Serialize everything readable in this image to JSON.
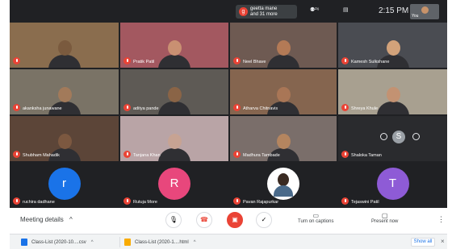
{
  "topbar": {
    "badge_letter": "g",
    "participants_badge": "geetta mane\nand 31 more",
    "layout_icon": "people-icon",
    "chat_icon": "chat-icon",
    "time": "2:15 PM",
    "self_label": "You"
  },
  "tiles": [
    {
      "name": "",
      "color": "#8a6d4e",
      "skin": "#7a5a3e"
    },
    {
      "name": "Pratik Patil",
      "color": "#a35860",
      "skin": "#c99072"
    },
    {
      "name": "Neel Bhave",
      "color": "#6e5a52",
      "skin": "#b37a56"
    },
    {
      "name": "Kamesh Sulkshane",
      "color": "#4a4c52",
      "skin": "#d2a27a"
    },
    {
      "name": "akanksha junawane",
      "color": "#7a7366",
      "skin": "#a27a5a"
    },
    {
      "name": "aditya pande",
      "color": "#5e5a55",
      "skin": "#8a6446"
    },
    {
      "name": "Atharva Chitnavis",
      "color": "#85654f",
      "skin": "#a97656"
    },
    {
      "name": "Shreya Khule",
      "color": "#a8a090",
      "skin": "#c39272"
    },
    {
      "name": "Shubham Mahadik",
      "color": "#5c4538",
      "skin": "#7c5840"
    },
    {
      "name": "Tanjana Khan",
      "color": "#b9a4a6",
      "skin": "#c7a393"
    },
    {
      "name": "Madhura Tambade",
      "color": "#7a6e6a",
      "skin": "#b4855f"
    },
    {
      "name": "Shaloka Taman",
      "color": "#2a2b2e",
      "skin": "#2a2b2e"
    }
  ],
  "avatars": [
    {
      "letter": "r",
      "name": "ruchira dadhane",
      "color": "#1a73e8"
    },
    {
      "letter": "R",
      "name": "Rutuja More",
      "color": "#e8477c"
    },
    {
      "letter": "",
      "name": "Pavan Rajapurkar",
      "color": "#ffffff"
    },
    {
      "letter": "T",
      "name": "Tejaswini Patil",
      "color": "#8e5bd6"
    }
  ],
  "overlay": {
    "letter": "S"
  },
  "bottom": {
    "meeting_details": "Meeting details",
    "chevron": "^",
    "captions": "Turn on captions",
    "present": "Present now",
    "kebab": "⋮"
  },
  "downloads": [
    {
      "name": "Class-List (2020-10....csv",
      "chevron": "^"
    },
    {
      "name": "Class-List (2020-1....html",
      "chevron": "^"
    }
  ],
  "download_bar": {
    "show_all": "Show all",
    "close": "×"
  }
}
